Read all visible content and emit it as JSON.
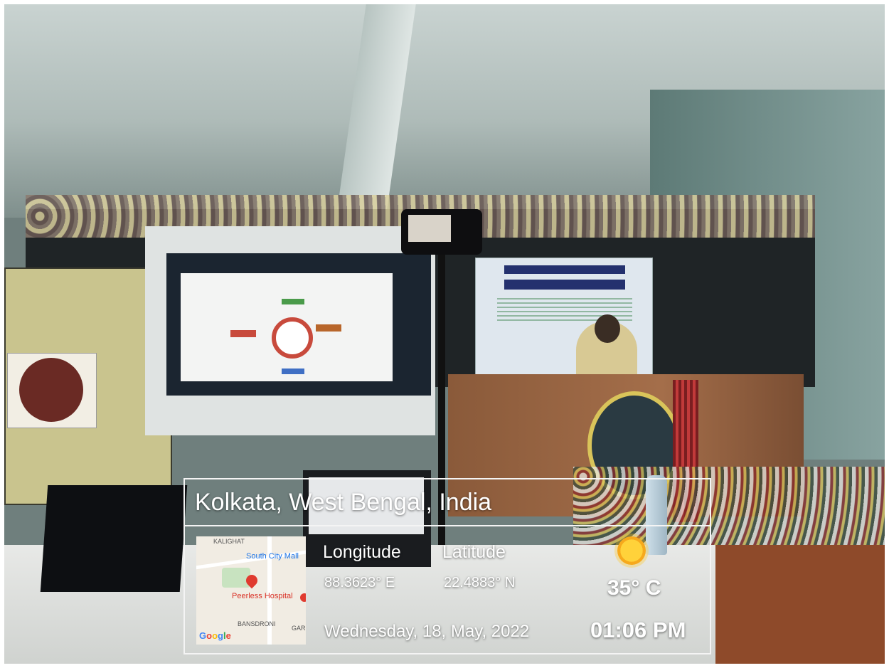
{
  "location": {
    "title": "Kolkata, West Bengal, India"
  },
  "map": {
    "places": {
      "top": "KALIGHAT",
      "mall": "South City Mall",
      "hospital": "Peerless Hospital",
      "bottom": "BANSDRONI",
      "right": "GARI"
    },
    "logo": [
      "G",
      "o",
      "o",
      "g",
      "l",
      "e"
    ]
  },
  "coordinates": {
    "longitude_label": "Longitude",
    "longitude_value": "88.3623° E",
    "latitude_label": "Latitude",
    "latitude_value": "22.4883° N"
  },
  "weather": {
    "icon": "sun-icon",
    "temperature": "35° C"
  },
  "datetime": {
    "date": "Wednesday, 18, May, 2022",
    "time": "01:06 PM"
  }
}
